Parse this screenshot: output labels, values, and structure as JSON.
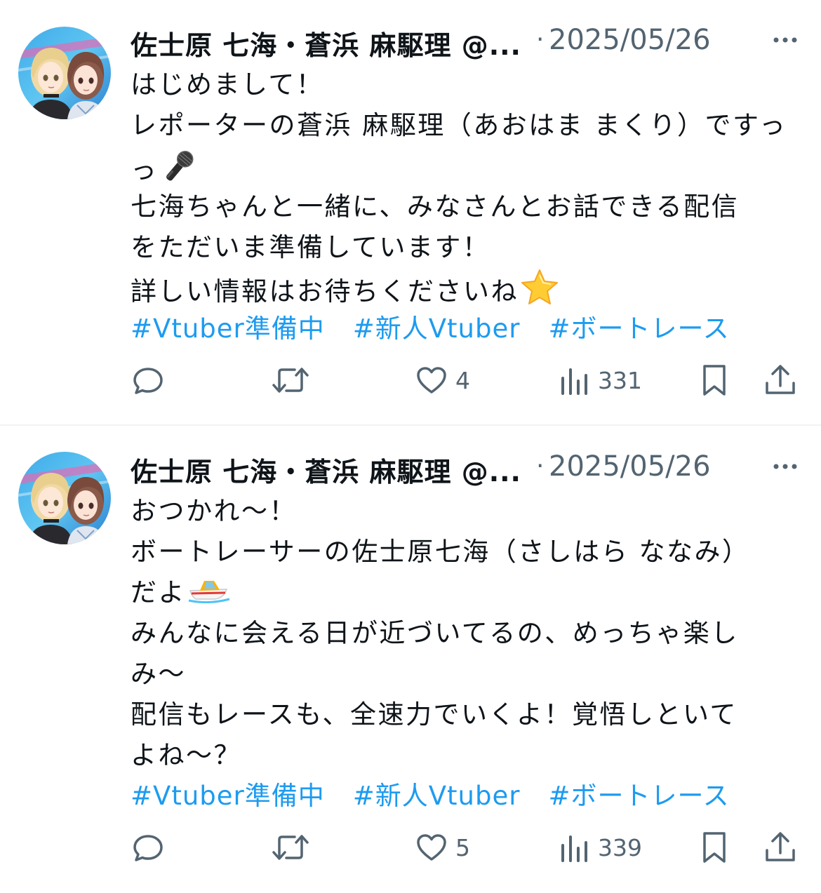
{
  "tweets": [
    {
      "display_name": "佐士原 七海・蒼浜 麻駆理 @...",
      "separator": "·",
      "date": "2025/05/26",
      "lines": [
        "はじめまして！",
        "レポーターの蒼浜 麻駆理（あおはま まくり）ですっ",
        "っ",
        "七海ちゃんと一緒に、みなさんとお話できる配信",
        "をただいま準備しています！",
        "詳しい情報はお待ちくださいね"
      ],
      "line_emojis": [
        "",
        "",
        "microphone",
        "",
        "",
        "star"
      ],
      "hashtags": [
        "#Vtuber準備中",
        "#新人Vtuber",
        "#ボートレース"
      ],
      "actions": {
        "reply_count": "",
        "retweet_count": "",
        "like_count": "4",
        "view_count": "331"
      }
    },
    {
      "display_name": "佐士原 七海・蒼浜 麻駆理 @...",
      "separator": "·",
      "date": "2025/05/26",
      "lines": [
        "おつかれ〜！",
        "ボートレーサーの佐士原七海（さしはら ななみ）",
        "だよ",
        "みんなに会える日が近づいてるの、めっちゃ楽し",
        "み〜",
        "配信もレースも、全速力でいくよ！覚悟しといて",
        "よね〜？"
      ],
      "line_emojis": [
        "",
        "",
        "speedboat",
        "",
        "",
        "",
        ""
      ],
      "hashtags": [
        "#Vtuber準備中",
        "#新人Vtuber",
        "#ボートレース"
      ],
      "actions": {
        "reply_count": "",
        "retweet_count": "",
        "like_count": "5",
        "view_count": "339"
      }
    }
  ],
  "colors": {
    "text": "#0f1419",
    "muted": "#536471",
    "link": "#1d9bf0",
    "divider": "#eff3f4"
  }
}
